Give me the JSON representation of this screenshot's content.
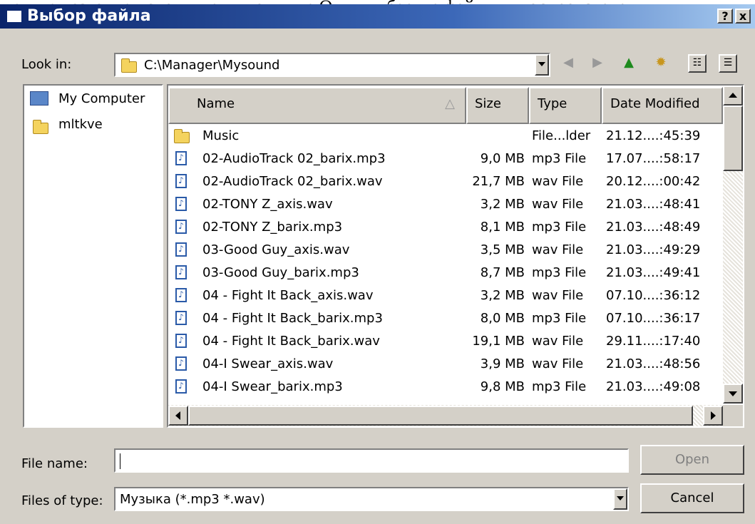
{
  "document_text": "едите название исполнителя, нажмите Ок, и выберите файл для воспроизведения",
  "window": {
    "title": "Выбор файла",
    "help_label": "?",
    "close_label": "x"
  },
  "look_in": {
    "label": "Look in:",
    "path": "C:\\Manager\\Mysound"
  },
  "nav_icons": [
    "back-icon",
    "forward-icon",
    "up-folder-icon",
    "new-folder-icon",
    "list-view-icon",
    "details-view-icon"
  ],
  "places": [
    {
      "label": "My Computer",
      "icon": "computer-icon"
    },
    {
      "label": "mltkve",
      "icon": "folder-icon"
    }
  ],
  "columns": {
    "name": "Name",
    "size": "Size",
    "type": "Type",
    "date": "Date Modified"
  },
  "files": [
    {
      "name": "Music",
      "size": "",
      "type": "File...lder",
      "date": "21.12....:45:39",
      "icon": "folder-icon"
    },
    {
      "name": "02-AudioTrack 02_barix.mp3",
      "size": "9,0 MB",
      "type": "mp3 File",
      "date": "17.07....:58:17",
      "icon": "audio-file-icon"
    },
    {
      "name": "02-AudioTrack 02_barix.wav",
      "size": "21,7 MB",
      "type": "wav File",
      "date": "20.12....:00:42",
      "icon": "audio-file-icon"
    },
    {
      "name": "02-TONY Z_axis.wav",
      "size": "3,2 MB",
      "type": "wav File",
      "date": "21.03....:48:41",
      "icon": "audio-file-icon"
    },
    {
      "name": "02-TONY Z_barix.mp3",
      "size": "8,1 MB",
      "type": "mp3 File",
      "date": "21.03....:48:49",
      "icon": "audio-file-icon"
    },
    {
      "name": "03-Good Guy_axis.wav",
      "size": "3,5 MB",
      "type": "wav File",
      "date": "21.03....:49:29",
      "icon": "audio-file-icon"
    },
    {
      "name": "03-Good Guy_barix.mp3",
      "size": "8,7 MB",
      "type": "mp3 File",
      "date": "21.03....:49:41",
      "icon": "audio-file-icon"
    },
    {
      "name": "04 - Fight It Back_axis.wav",
      "size": "3,2 MB",
      "type": "wav File",
      "date": "07.10....:36:12",
      "icon": "audio-file-icon"
    },
    {
      "name": "04 - Fight It Back_barix.mp3",
      "size": "8,0 MB",
      "type": "mp3 File",
      "date": "07.10....:36:17",
      "icon": "audio-file-icon"
    },
    {
      "name": "04 - Fight It Back_barix.wav",
      "size": "19,1 MB",
      "type": "wav File",
      "date": "29.11....:17:40",
      "icon": "audio-file-icon"
    },
    {
      "name": "04-I Swear_axis.wav",
      "size": "3,9 MB",
      "type": "wav File",
      "date": "21.03....:48:56",
      "icon": "audio-file-icon"
    },
    {
      "name": "04-I Swear_barix.mp3",
      "size": "9,8 MB",
      "type": "mp3 File",
      "date": "21.03....:49:08",
      "icon": "audio-file-icon"
    }
  ],
  "file_name": {
    "label": "File name:",
    "value": ""
  },
  "files_of_type": {
    "label": "Files of type:",
    "value": "Музыка (*.mp3 *.wav)"
  },
  "buttons": {
    "open": "Open",
    "cancel": "Cancel"
  }
}
